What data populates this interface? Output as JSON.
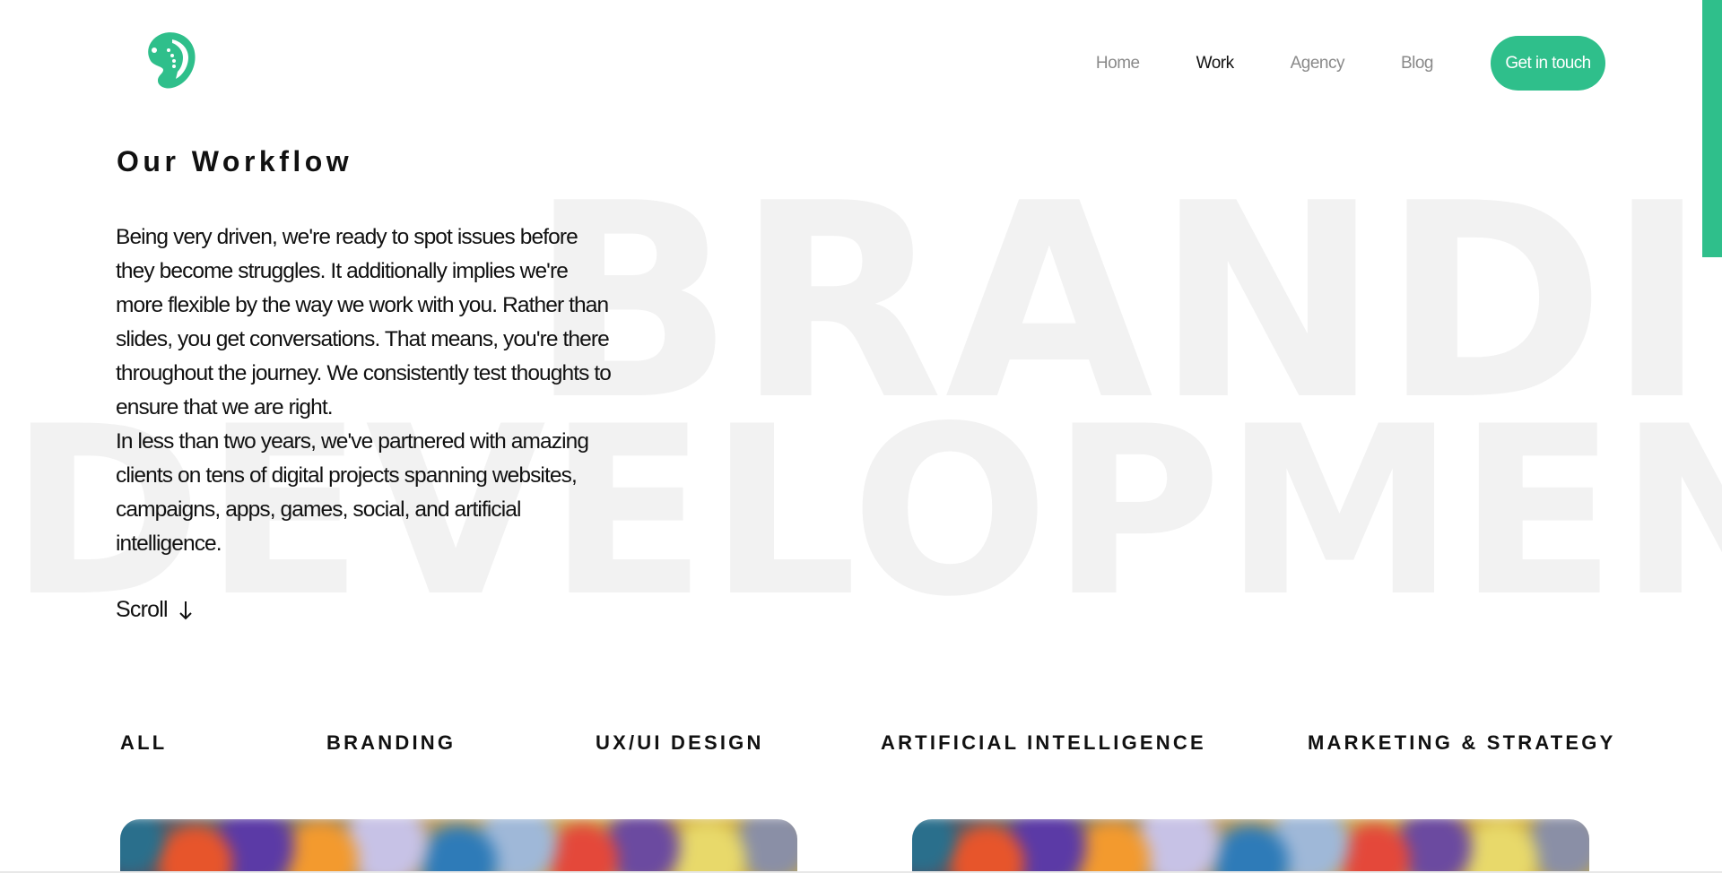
{
  "colors": {
    "accent": "#2fbf8b",
    "text": "#111111",
    "nav_inactive": "#8a8a8a",
    "bg_word": "#f2f2f2"
  },
  "header": {
    "logo_icon": "guitar-head-logo",
    "nav": [
      {
        "label": "Home",
        "active": false
      },
      {
        "label": "Work",
        "active": true
      },
      {
        "label": "Agency",
        "active": false
      },
      {
        "label": "Blog",
        "active": false
      }
    ],
    "cta_label": "Get in touch"
  },
  "background_words": {
    "top": "BRANDIN",
    "bottom": "DEVELOPMENT"
  },
  "hero": {
    "title": "Our Workflow",
    "paragraph_1": "Being very driven, we're ready to spot issues before they become struggles. It additionally implies we're more flexible by the way we work with you. Rather than slides, you get conversations. That means, you're there throughout the journey. We consistently test thoughts to ensure that we are right.",
    "paragraph_2": "In less than two years, we've partnered with amazing clients on tens of digital projects spanning websites, campaigns, apps, games, social, and artificial intelligence.",
    "scroll_label": "Scroll",
    "scroll_icon": "arrow-down-icon"
  },
  "filters": {
    "all": "ALL",
    "branding": "BRANDING",
    "uxui": "UX/UI DESIGN",
    "ai": "ARTIFICIAL INTELLIGENCE",
    "marketing": "MARKETING & STRATEGY"
  }
}
